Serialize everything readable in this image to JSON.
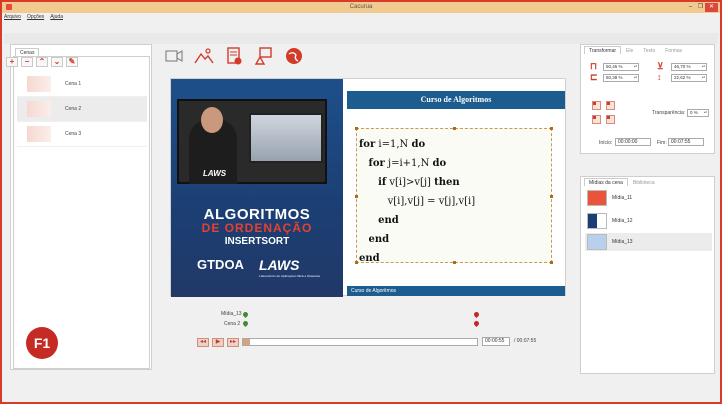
{
  "window": {
    "title": "Cacurua",
    "minimize": "–",
    "maximize": "❐",
    "close": "✕"
  },
  "menu": {
    "items": [
      "Arquivo",
      "Opções",
      "Ajuda"
    ]
  },
  "scenes_panel": {
    "tab": "Cenas",
    "tools": [
      "+",
      "−",
      "⌃",
      "⌄",
      "✎"
    ],
    "items": [
      {
        "label": "Cena 1",
        "selected": false
      },
      {
        "label": "Cena 2",
        "selected": true
      },
      {
        "label": "Cena 3",
        "selected": false
      }
    ],
    "badge": "F1"
  },
  "toolbar": {
    "icons": [
      "video-icon",
      "image-icon",
      "document-icon",
      "shapes-icon",
      "web-icon"
    ]
  },
  "slide": {
    "left": {
      "title1": "ALGORITMOS",
      "title2": "DE ORDENAÇÃO",
      "title3": "INSERTSORT",
      "logo1": "GTDOA",
      "logo2": "LAWS",
      "logo_caption": "Laboratório de Aplicações Web e Sistemas",
      "video_logo": "LAWS"
    },
    "right": {
      "header": "Curso de Algoritmos",
      "code": [
        "for i=1,N do",
        "   for j=i+1,N do",
        "      if v[i]>v[j] then",
        "         v[i],v[j] = v[j],v[i]",
        "      end",
        "   end",
        "end"
      ],
      "footer": "Curso de Algoritmos"
    }
  },
  "timeline": {
    "tracks": [
      {
        "label": "Mídia_13"
      },
      {
        "label": "Cena 2"
      }
    ],
    "controls": [
      "◂◂",
      "▶",
      "▸▸"
    ],
    "progress_fraction": 0.03,
    "current_time": "00:00:55",
    "total_time": "/ 00:07:55"
  },
  "properties": {
    "tabs": [
      {
        "label": "Transformar",
        "active": true
      },
      {
        "label": "Ele",
        "active": false
      },
      {
        "label": "Texto",
        "active": false
      },
      {
        "label": "Formas",
        "active": false
      }
    ],
    "width": "50,45 %",
    "height": "60,38 %",
    "x_pos": "46,70 %",
    "y_pos": "22,62 %",
    "transparency_label": "Transparência:",
    "transparency_value": "0 %",
    "start_label": "Início:",
    "start_value": "00:00:00",
    "end_label": "Fim:",
    "end_value": "00:07:55"
  },
  "media_panel": {
    "tabs": [
      {
        "label": "Mídias da cena",
        "active": true
      },
      {
        "label": "Biblioteca",
        "active": false
      }
    ],
    "items": [
      {
        "label": "Mídia_11",
        "selected": false
      },
      {
        "label": "Mídia_12",
        "selected": false
      },
      {
        "label": "Mídia_13",
        "selected": true
      }
    ]
  },
  "colors": {
    "accent": "#d23b2a",
    "title_bar": "#f0ca8e",
    "slide_blue": "#1d5c8e"
  }
}
